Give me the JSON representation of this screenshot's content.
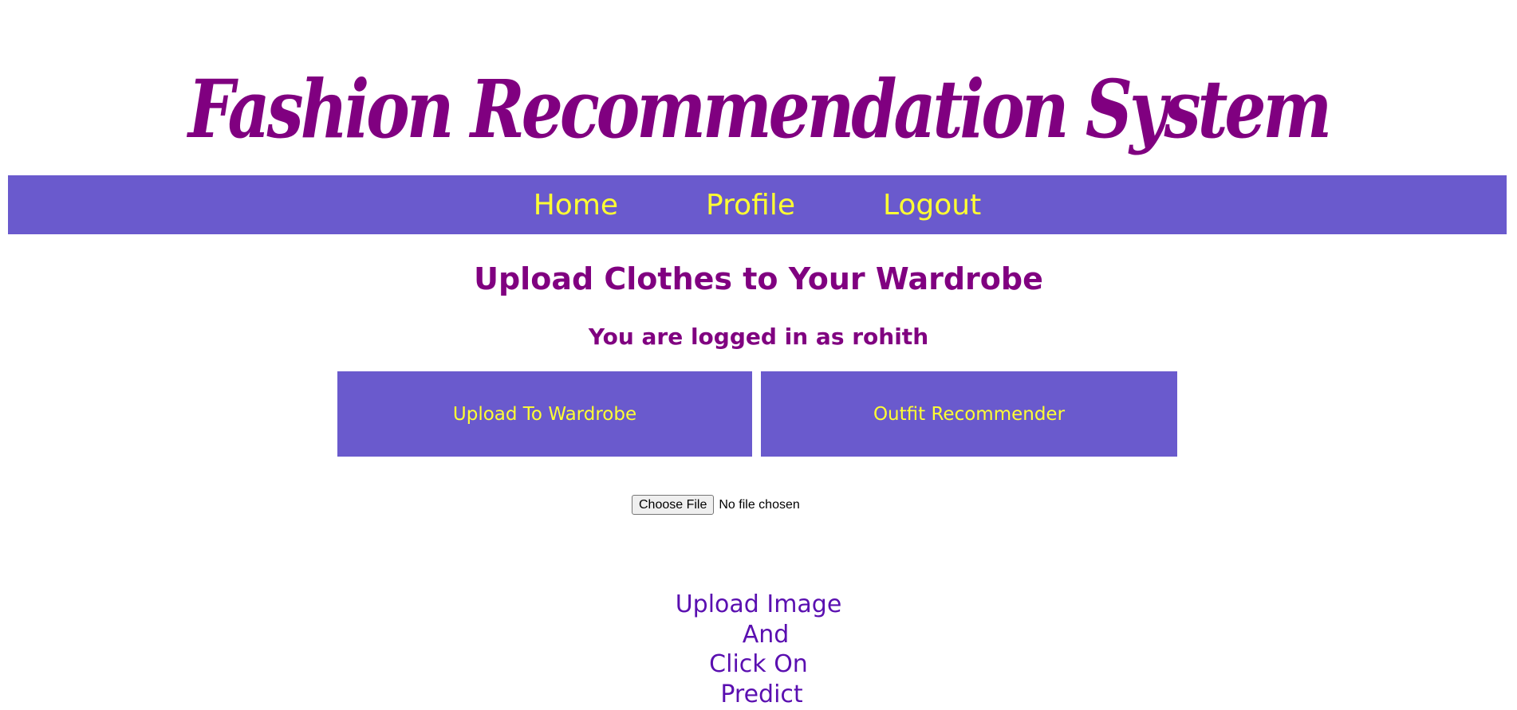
{
  "site": {
    "title": "Fashion Recommendation System"
  },
  "nav": {
    "items": [
      {
        "label": "Home"
      },
      {
        "label": "Profile"
      },
      {
        "label": "Logout"
      }
    ]
  },
  "main": {
    "heading": "Upload Clothes to Your Wardrobe",
    "logged_in_text": "You are logged in as rohith",
    "buttons": {
      "upload": "Upload To Wardrobe",
      "outfit": "Outfit Recommender"
    },
    "file_input": {
      "button_label": "Choose File",
      "status": "No file chosen"
    },
    "instructions": {
      "line1": "Upload Image",
      "line2": "And",
      "line3": "Click On",
      "line4": "Predict"
    }
  },
  "colors": {
    "title": "#800080",
    "nav_background": "#6a5acd",
    "nav_text": "#ffff33",
    "heading": "#800080",
    "instructions": "#5a0fb0"
  }
}
